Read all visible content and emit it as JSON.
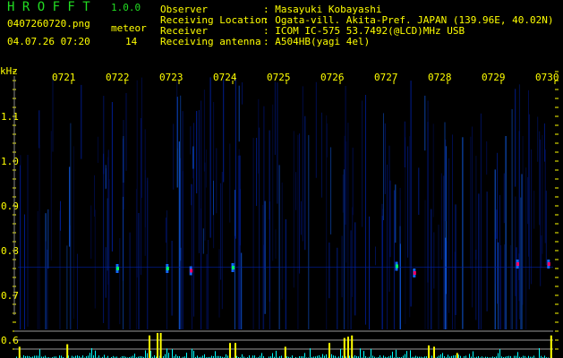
{
  "header": {
    "app_name": "H R O F F T",
    "version": "1.0.0",
    "filename": "0407260720.png",
    "datetime": "04.07.26 07:20",
    "meteor_label": "meteor",
    "meteor_count": "14",
    "info": [
      {
        "label": "Observer",
        "value": ": Masayuki Kobayashi"
      },
      {
        "label": "Receiving Location",
        "value": ": Ogata-vill. Akita-Pref. JAPAN (139.96E, 40.02N)"
      },
      {
        "label": "Receiver",
        "value": ": ICOM IC-575 53.7492(@LCD)MHz USB"
      },
      {
        "label": "Receiving antenna",
        "value": ": A504HB(yagi 4el)"
      }
    ]
  },
  "colors": {
    "text": "#ffff00",
    "title": "#22dd22",
    "noise": "#0033cc",
    "echo_strong": "#ff0066",
    "echo_mid": "#00ff66",
    "count_bar": "#00ffff",
    "detect_bar": "#ffff00",
    "grid": "#999999"
  },
  "chart_data": {
    "type": "heatmap",
    "ylabel": "kHz",
    "y_ticks": [
      "1.1",
      "1.0",
      "0.9",
      "0.8",
      "0.7",
      "0.6"
    ],
    "ylim": [
      0.58,
      1.2
    ],
    "x_ticks": [
      "0721",
      "0722",
      "0723",
      "0724",
      "0725",
      "0726",
      "0727",
      "0728",
      "0729",
      "0730"
    ],
    "xlim_minutes": [
      0,
      10
    ],
    "echoes": [
      {
        "minute": 1.85,
        "khz": 0.76,
        "strength": 0.5
      },
      {
        "minute": 2.78,
        "khz": 0.76,
        "strength": 0.6
      },
      {
        "minute": 3.22,
        "khz": 0.755,
        "strength": 1.0
      },
      {
        "minute": 4.0,
        "khz": 0.762,
        "strength": 0.6
      },
      {
        "minute": 7.05,
        "khz": 0.765,
        "strength": 0.6
      },
      {
        "minute": 7.38,
        "khz": 0.75,
        "strength": 1.0
      },
      {
        "minute": 9.3,
        "khz": 0.77,
        "strength": 0.9
      },
      {
        "minute": 9.88,
        "khz": 0.77,
        "strength": 1.0
      }
    ],
    "detection_bars": [
      {
        "minute": 0.03,
        "level": 0.45
      },
      {
        "minute": 0.92,
        "level": 0.55
      },
      {
        "minute": 2.45,
        "level": 0.9
      },
      {
        "minute": 2.6,
        "level": 1.0
      },
      {
        "minute": 2.66,
        "level": 1.0
      },
      {
        "minute": 3.95,
        "level": 0.6
      },
      {
        "minute": 4.05,
        "level": 0.6
      },
      {
        "minute": 4.98,
        "level": 0.45
      },
      {
        "minute": 5.8,
        "level": 0.6
      },
      {
        "minute": 6.08,
        "level": 0.8
      },
      {
        "minute": 6.15,
        "level": 0.85
      },
      {
        "minute": 6.22,
        "level": 0.9
      },
      {
        "minute": 7.65,
        "level": 0.5
      },
      {
        "minute": 7.75,
        "level": 0.45
      },
      {
        "minute": 8.18,
        "level": 0.2
      },
      {
        "minute": 9.93,
        "level": 0.9
      }
    ]
  }
}
